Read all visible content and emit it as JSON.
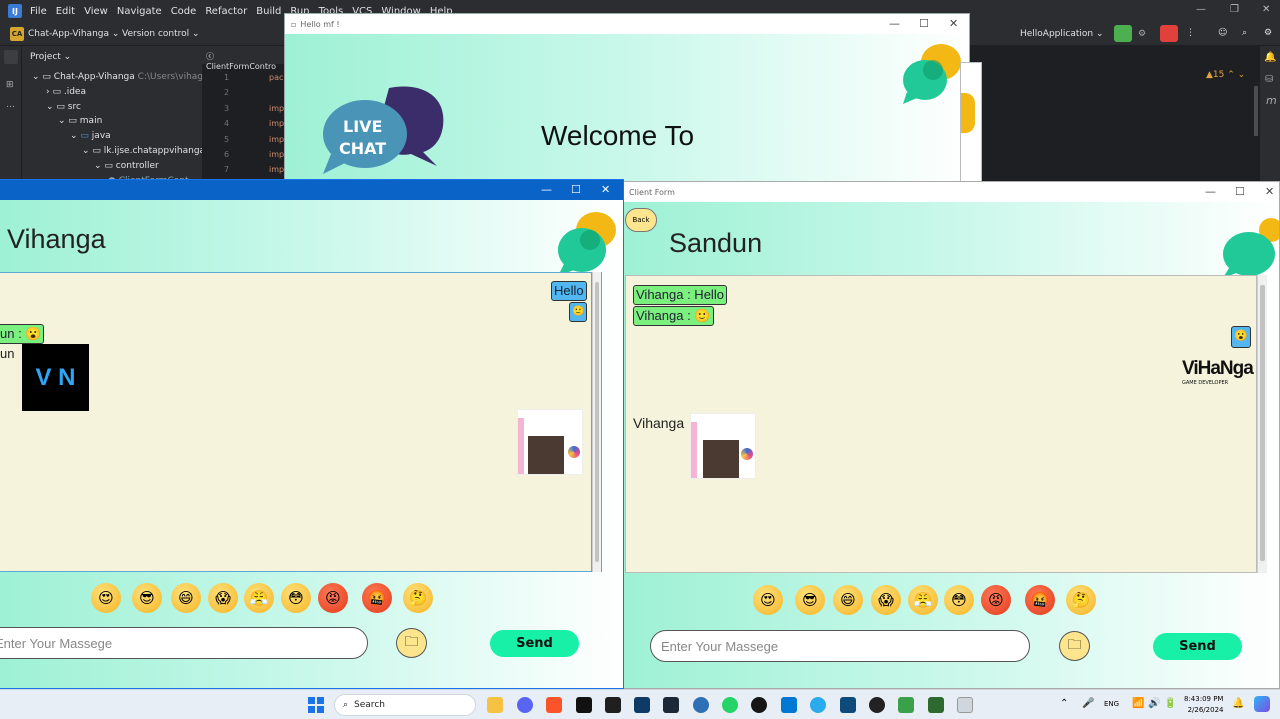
{
  "ide": {
    "menu": [
      "File",
      "Edit",
      "View",
      "Navigate",
      "Code",
      "Refactor",
      "Build",
      "Run",
      "Tools",
      "VCS",
      "Window",
      "Help"
    ],
    "project_badge": "CA",
    "project_name": "Chat-App-Vihanga",
    "version_control": "Version control",
    "run_config": "HelloApplication",
    "panel_title": "Project",
    "tree": [
      {
        "label": "Chat-App-Vihanga",
        "hint": "C:\\Users\\vihag\\"
      },
      {
        "label": ".idea"
      },
      {
        "label": "src"
      },
      {
        "label": "main"
      },
      {
        "label": "java"
      },
      {
        "label": "lk.ijse.chatappvihanga"
      },
      {
        "label": "controller"
      },
      {
        "label": "ClientFormCont"
      }
    ],
    "editor_tab": "ClientFormContro",
    "line_numbers": [
      "1",
      "2",
      "3",
      "4",
      "5",
      "6",
      "7"
    ],
    "code_snippets": [
      "pac",
      "imp",
      "imp",
      "imp",
      "imp",
      "imp"
    ],
    "warnings": "15"
  },
  "hello_window": {
    "title": "Hello mf !",
    "logo_line1": "LIVE",
    "logo_line2": "CHAT",
    "heading": "Welcome To"
  },
  "left_client": {
    "name": "Vihanga",
    "messages": {
      "mine_text": "Hello",
      "mine_emoji": "🙂",
      "from_sandun_prefix": "un : ",
      "from_sandun_emoji": "😮",
      "from_sandun_img_prefix": "un",
      "vn_logo": "V N"
    },
    "placeholder": "Enter Your Massege",
    "send_label": "Send"
  },
  "right_client": {
    "title": "Client Form",
    "back_label": "Back",
    "name": "Sandun",
    "messages": {
      "from_vihanga_1": "Vihanga : Hello",
      "from_vihanga_2_prefix": "Vihanga : ",
      "from_vihanga_2_emoji": "🙂",
      "mine_emoji": "😮",
      "vihanga_logo_top": "ViHaNga",
      "vihanga_logo_bottom": "GAME DEVELOPER",
      "img_sender": "Vihanga"
    },
    "placeholder": "Enter Your Massege",
    "send_label": "Send"
  },
  "emojis": [
    "😍",
    "😎",
    "😄",
    "😱",
    "😤",
    "😳",
    "😡",
    "🤬",
    "🤔"
  ],
  "taskbar": {
    "search": "Search",
    "lang": "ENG",
    "time": "8:43:09 PM",
    "date": "2/26/2024"
  }
}
